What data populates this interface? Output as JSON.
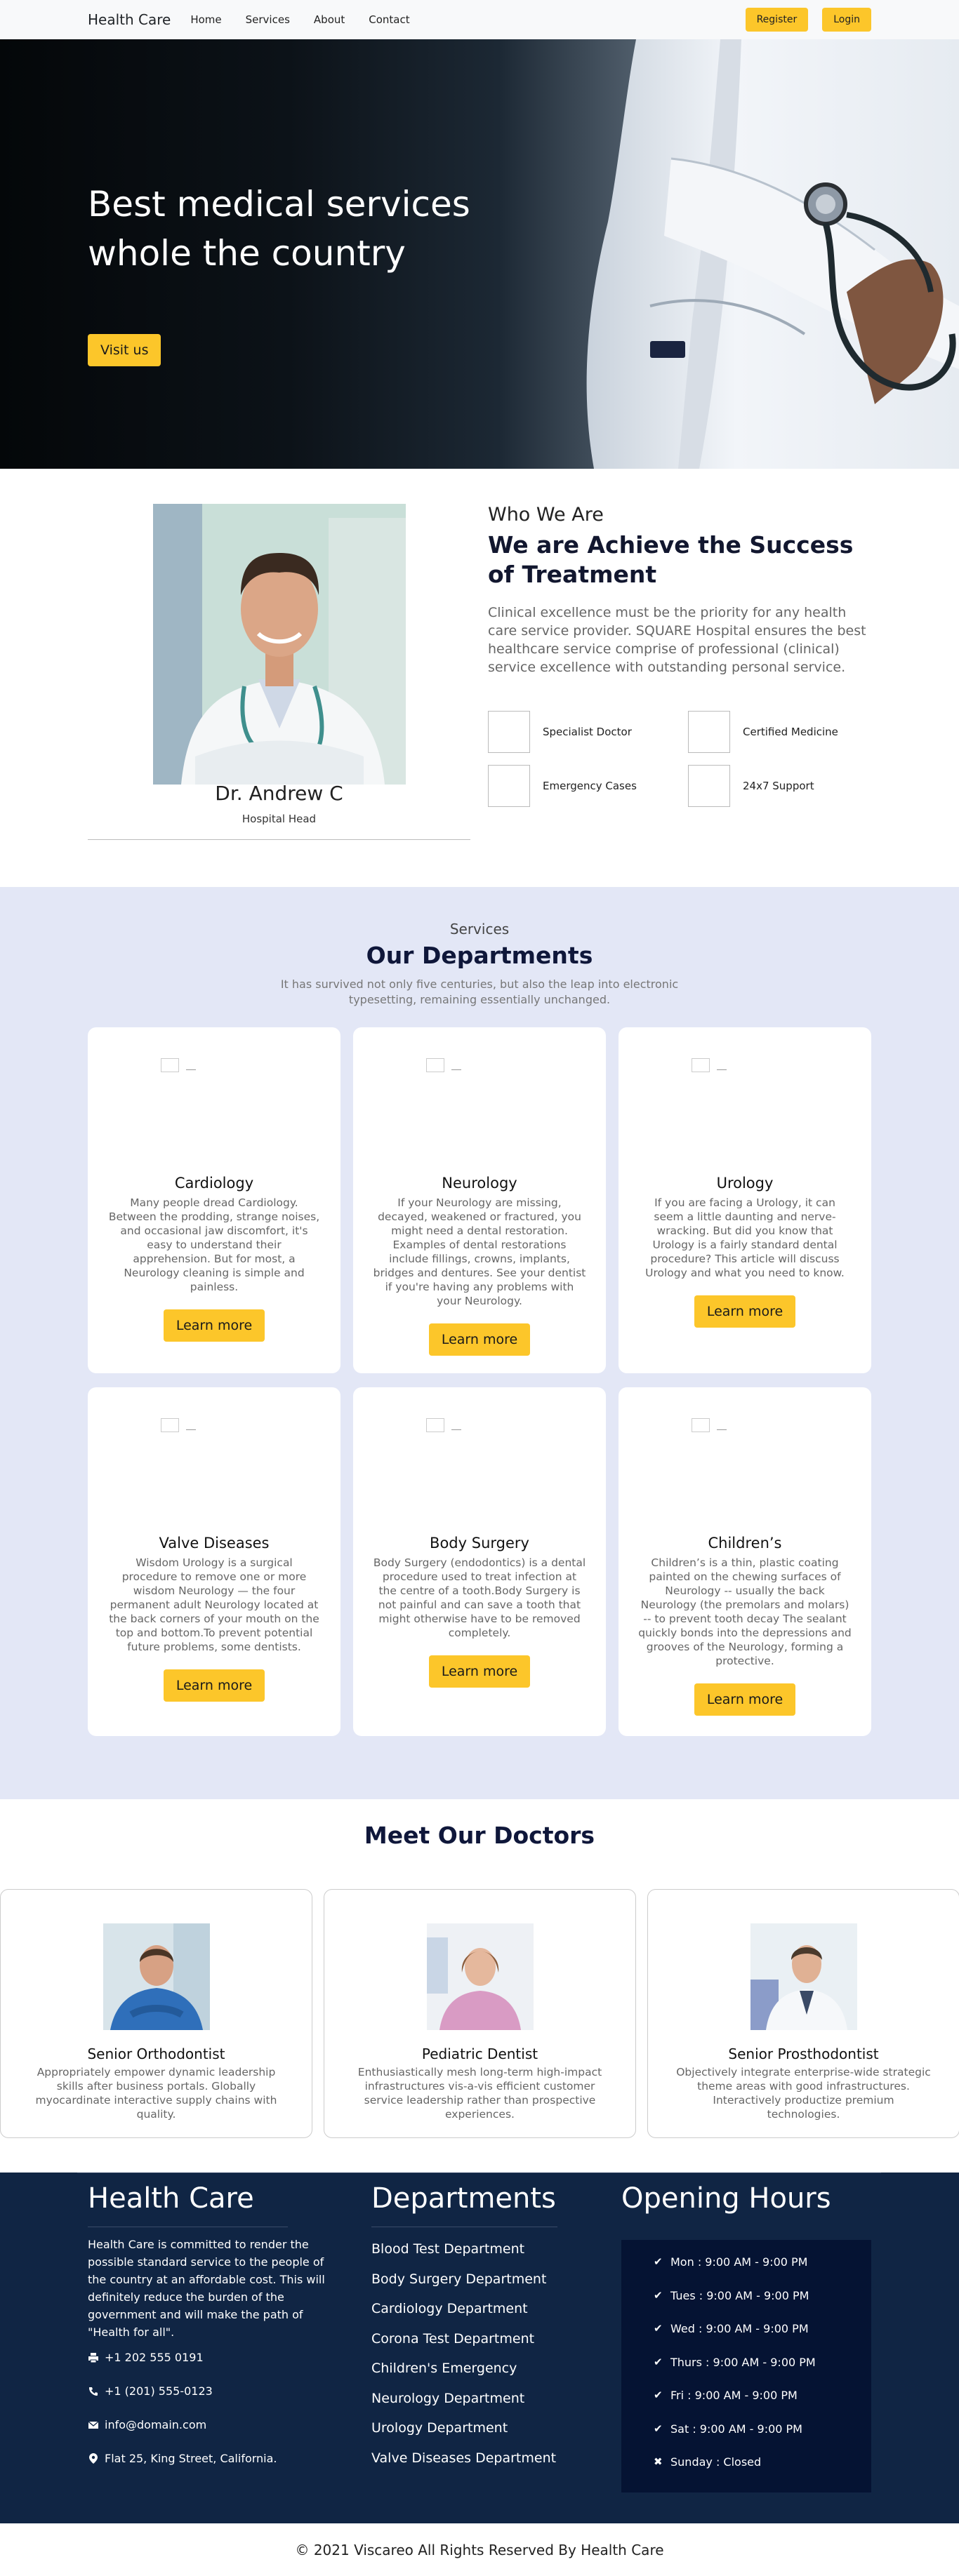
{
  "nav": {
    "brand": "Health Care",
    "links": [
      "Home",
      "Services",
      "About",
      "Contact"
    ],
    "register": "Register",
    "login": "Login"
  },
  "hero": {
    "title_line1": "Best medical services",
    "title_line2": "whole the country",
    "button": "Visit us"
  },
  "who": {
    "doctor_name": "Dr. Andrew C",
    "doctor_role": "Hospital Head",
    "kicker": "Who We Are",
    "title": "We are Achieve the Success of Treatment",
    "text": "Clinical excellence must be the priority for any health care service provider. SQUARE Hospital ensures the best healthcare service comprise of professional (clinical) service excellence with outstanding personal service.",
    "features": [
      "Specialist Doctor",
      "Certified Medicine",
      "Emergency Cases",
      "24x7 Support"
    ]
  },
  "departments": {
    "kicker": "Services",
    "title": "Our Departments",
    "subtitle_line1": "It has survived not only five centuries, but also the leap into electronic",
    "subtitle_line2": "typesetting, remaining essentially unchanged.",
    "button": "Learn more",
    "cards": [
      {
        "title": "Cardiology",
        "text": "Many people dread Cardiology. Between the prodding, strange noises, and occasional jaw discomfort, it's easy to understand their apprehension. But for most, a Neurology cleaning is simple and painless."
      },
      {
        "title": "Neurology",
        "text": "If your Neurology are missing, decayed, weakened or fractured, you might need a dental restoration. Examples of dental restorations include fillings, crowns, implants, bridges and dentures. See your dentist if you're having any problems with your Neurology."
      },
      {
        "title": "Urology",
        "text": "If you are facing a Urology, it can seem a little daunting and nerve-wracking. But did you know that Urology is a fairly standard dental procedure? This article will discuss Urology and what you need to know."
      },
      {
        "title": "Valve Diseases",
        "text": "Wisdom Urology is a surgical procedure to remove one or more wisdom Neurology — the four permanent adult Neurology located at the back corners of your mouth on the top and bottom.To prevent potential future problems, some dentists."
      },
      {
        "title": "Body Surgery",
        "text": "Body Surgery (endodontics) is a dental procedure used to treat infection at the centre of a tooth.Body Surgery is not painful and can save a tooth that might otherwise have to be removed completely."
      },
      {
        "title": "Children’s",
        "text": "Children’s is a thin, plastic coating painted on the chewing surfaces of Neurology -- usually the back Neurology (the premolars and molars) -- to prevent tooth decay The sealant quickly bonds into the depressions and grooves of the Neurology, forming a protective."
      }
    ]
  },
  "doctors": {
    "title": "Meet Our Doctors",
    "cards": [
      {
        "title": "Senior Orthodontist",
        "text": "Appropriately empower dynamic leadership skills after business portals. Globally myocardinate interactive supply chains with quality."
      },
      {
        "title": "Pediatric Dentist",
        "text": "Enthusiastically mesh long-term high-impact infrastructures vis-a-vis efficient customer service leadership rather than prospective experiences."
      },
      {
        "title": "Senior Prosthodontist",
        "text": "Objectively integrate enterprise-wide strategic theme areas with good infrastructures. Interactively productize premium technologies."
      }
    ]
  },
  "footer": {
    "brand": "Health Care",
    "about": "Health Care is committed to render the possible standard service to the people of the country at an affordable cost. This will definitely reduce the burden of the government and will make the path of \"Health for all\".",
    "phone1": "+1 202 555 0191",
    "phone2": "+1 (201) 555-0123",
    "email": "info@domain.com",
    "address": "Flat 25, King Street, California.",
    "departments_title": "Departments",
    "departments": [
      "Blood Test Department",
      "Body Surgery Department",
      "Cardiology Department",
      "Corona Test Department",
      "Children's Emergency",
      "Neurology Department",
      "Urology Department",
      "Valve Diseases Department"
    ],
    "hours_title": "Opening Hours",
    "hours": [
      "Mon : 9:00 AM - 9:00 PM",
      "Tues : 9:00 AM - 9:00 PM",
      "Wed : 9:00 AM - 9:00 PM",
      "Thurs : 9:00 AM - 9:00 PM",
      "Fri : 9:00 AM - 9:00 PM",
      "Sat : 9:00 AM - 9:00 PM",
      "Sunday : Closed"
    ],
    "copyright": "© 2021 Viscareo All Rights Reserved By Health Care"
  }
}
